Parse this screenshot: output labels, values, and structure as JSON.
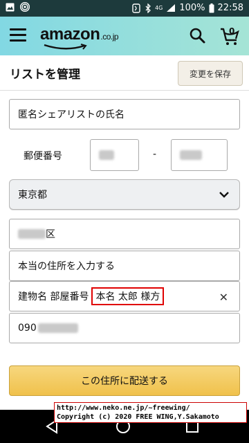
{
  "status_bar": {
    "battery": "100%",
    "time": "22:58",
    "network": "4G"
  },
  "header": {
    "logo_text": "amazon",
    "logo_suffix": ".co.jp"
  },
  "page": {
    "title": "リストを管理",
    "save_label": "変更を保存"
  },
  "form": {
    "name_value": "匿名シェアリストの氏名",
    "zip_label": "郵便番号",
    "zip_separator": "-",
    "prefecture": "東京都",
    "city_suffix": "区",
    "address_line": "本当の住所を入力する",
    "building_placeholder": "建物名 部屋番号",
    "building_highlight": "本名 太郎 様方",
    "phone_prefix": "090"
  },
  "submit_label": "この住所に配送する",
  "watermark": {
    "line1": "http://www.neko.ne.jp/~freewing/",
    "line2": "Copyright (c) 2020 FREE WING,Y.Sakamoto"
  },
  "colors": {
    "appbar_start": "#82d8e3",
    "appbar_end": "#a5e4d6",
    "submit": "#f0c14b",
    "highlight_border": "#e00000"
  }
}
